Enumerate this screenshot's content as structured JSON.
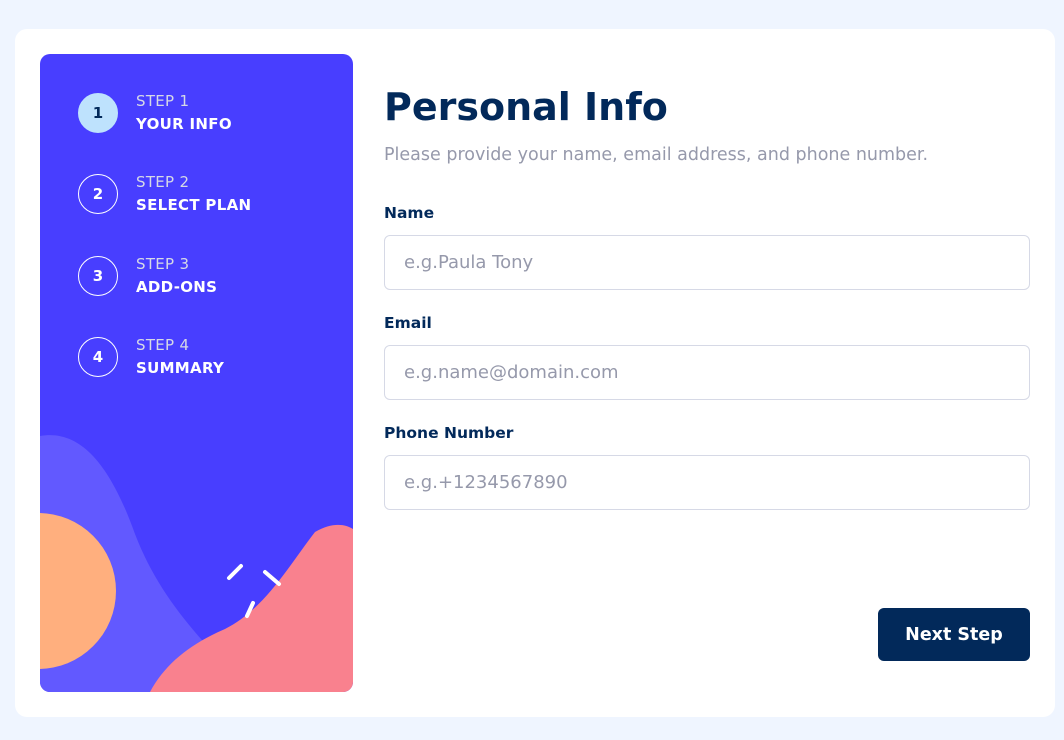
{
  "sidebar": {
    "steps": [
      {
        "number": "1",
        "label": "STEP 1",
        "name": "YOUR INFO",
        "active": true
      },
      {
        "number": "2",
        "label": "STEP 2",
        "name": "SELECT PLAN",
        "active": false
      },
      {
        "number": "3",
        "label": "STEP 3",
        "name": "ADD-ONS",
        "active": false
      },
      {
        "number": "4",
        "label": "STEP 4",
        "name": "SUMMARY",
        "active": false
      }
    ]
  },
  "form": {
    "title": "Personal Info",
    "subtitle": "Please provide your name, email address, and phone number.",
    "fields": [
      {
        "label": "Name",
        "placeholder": "e.g.Paula Tony",
        "value": ""
      },
      {
        "label": "Email",
        "placeholder": "e.g.name@domain.com",
        "value": ""
      },
      {
        "label": "Phone Number",
        "placeholder": "e.g.+1234567890",
        "value": ""
      }
    ],
    "next_label": "Next Step"
  },
  "colors": {
    "page_bg": "#eff5ff",
    "sidebar_bg": "#483eff",
    "active_step_bg": "#bee2fd",
    "primary_text": "#02295a",
    "muted_text": "#9699ab",
    "border": "#d6d9e6",
    "blob_purple": "#6259ff",
    "blob_orange": "#ffaf7e",
    "blob_pink": "#f9818e"
  }
}
